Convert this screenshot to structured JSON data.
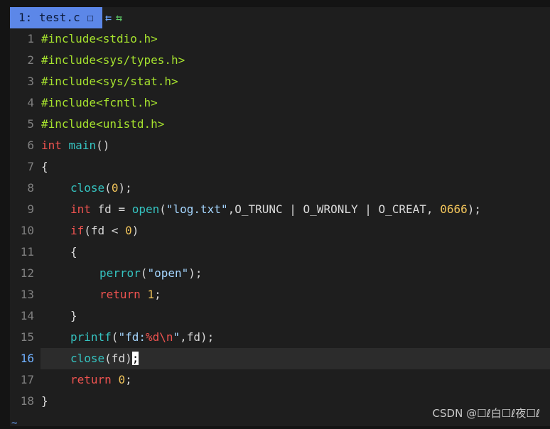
{
  "tabline": {
    "tab_label": "1: test.c ☐",
    "icon1": "⇇",
    "icon2": "⇆"
  },
  "lines": [
    {
      "num": "1",
      "indent": 0,
      "tokens": [
        [
          "pp",
          "#include"
        ],
        [
          "inc",
          "<stdio.h>"
        ]
      ]
    },
    {
      "num": "2",
      "indent": 0,
      "tokens": [
        [
          "pp",
          "#include"
        ],
        [
          "inc",
          "<sys/types.h>"
        ]
      ]
    },
    {
      "num": "3",
      "indent": 0,
      "tokens": [
        [
          "pp",
          "#include"
        ],
        [
          "inc",
          "<sys/stat.h>"
        ]
      ]
    },
    {
      "num": "4",
      "indent": 0,
      "tokens": [
        [
          "pp",
          "#include"
        ],
        [
          "inc",
          "<fcntl.h>"
        ]
      ]
    },
    {
      "num": "5",
      "indent": 0,
      "tokens": [
        [
          "pp",
          "#include"
        ],
        [
          "inc",
          "<unistd.h>"
        ]
      ]
    },
    {
      "num": "6",
      "indent": 0,
      "tokens": [
        [
          "kw",
          "int"
        ],
        [
          "pl",
          " "
        ],
        [
          "fn",
          "main"
        ],
        [
          "pl",
          "()"
        ]
      ]
    },
    {
      "num": "7",
      "indent": 0,
      "tokens": [
        [
          "pl",
          "{"
        ]
      ]
    },
    {
      "num": "8",
      "indent": 1,
      "tokens": [
        [
          "fn",
          "close"
        ],
        [
          "pl",
          "("
        ],
        [
          "num",
          "0"
        ],
        [
          "pl",
          ");"
        ]
      ]
    },
    {
      "num": "9",
      "indent": 1,
      "tokens": [
        [
          "kw",
          "int"
        ],
        [
          "pl",
          " fd = "
        ],
        [
          "fn",
          "open"
        ],
        [
          "pl",
          "("
        ],
        [
          "str",
          "\"log.txt\""
        ],
        [
          "pl",
          ",O_TRUNC | O_WRONLY | O_CREAT, "
        ],
        [
          "num",
          "0666"
        ],
        [
          "pl",
          ");"
        ]
      ]
    },
    {
      "num": "10",
      "indent": 1,
      "tokens": [
        [
          "kw",
          "if"
        ],
        [
          "pl",
          "(fd < "
        ],
        [
          "num",
          "0"
        ],
        [
          "pl",
          ")"
        ]
      ]
    },
    {
      "num": "11",
      "indent": 1,
      "tokens": [
        [
          "pl",
          "{"
        ]
      ]
    },
    {
      "num": "12",
      "indent": 2,
      "tokens": [
        [
          "fn",
          "perror"
        ],
        [
          "pl",
          "("
        ],
        [
          "str",
          "\"open\""
        ],
        [
          "pl",
          ");"
        ]
      ]
    },
    {
      "num": "13",
      "indent": 2,
      "tokens": [
        [
          "kw",
          "return"
        ],
        [
          "pl",
          " "
        ],
        [
          "num",
          "1"
        ],
        [
          "pl",
          ";"
        ]
      ]
    },
    {
      "num": "14",
      "indent": 1,
      "tokens": [
        [
          "pl",
          "}"
        ]
      ]
    },
    {
      "num": "15",
      "indent": 1,
      "tokens": [
        [
          "fn",
          "printf"
        ],
        [
          "pl",
          "("
        ],
        [
          "str",
          "\"fd:"
        ],
        [
          "esc",
          "%d\\n"
        ],
        [
          "str",
          "\""
        ],
        [
          "pl",
          ",fd);"
        ]
      ]
    },
    {
      "num": "16",
      "indent": 1,
      "current": true,
      "tokens": [
        [
          "fn",
          "close"
        ],
        [
          "pl",
          "(fd)"
        ],
        [
          "cursor",
          ";"
        ]
      ]
    },
    {
      "num": "17",
      "indent": 1,
      "tokens": [
        [
          "kw",
          "return"
        ],
        [
          "pl",
          " "
        ],
        [
          "num",
          "0"
        ],
        [
          "pl",
          ";"
        ]
      ]
    },
    {
      "num": "18",
      "indent": 0,
      "tokens": [
        [
          "pl",
          "}"
        ]
      ]
    }
  ],
  "tilde": "~",
  "watermark": "CSDN @☐ℓ白☐ℓ夜☐ℓ"
}
